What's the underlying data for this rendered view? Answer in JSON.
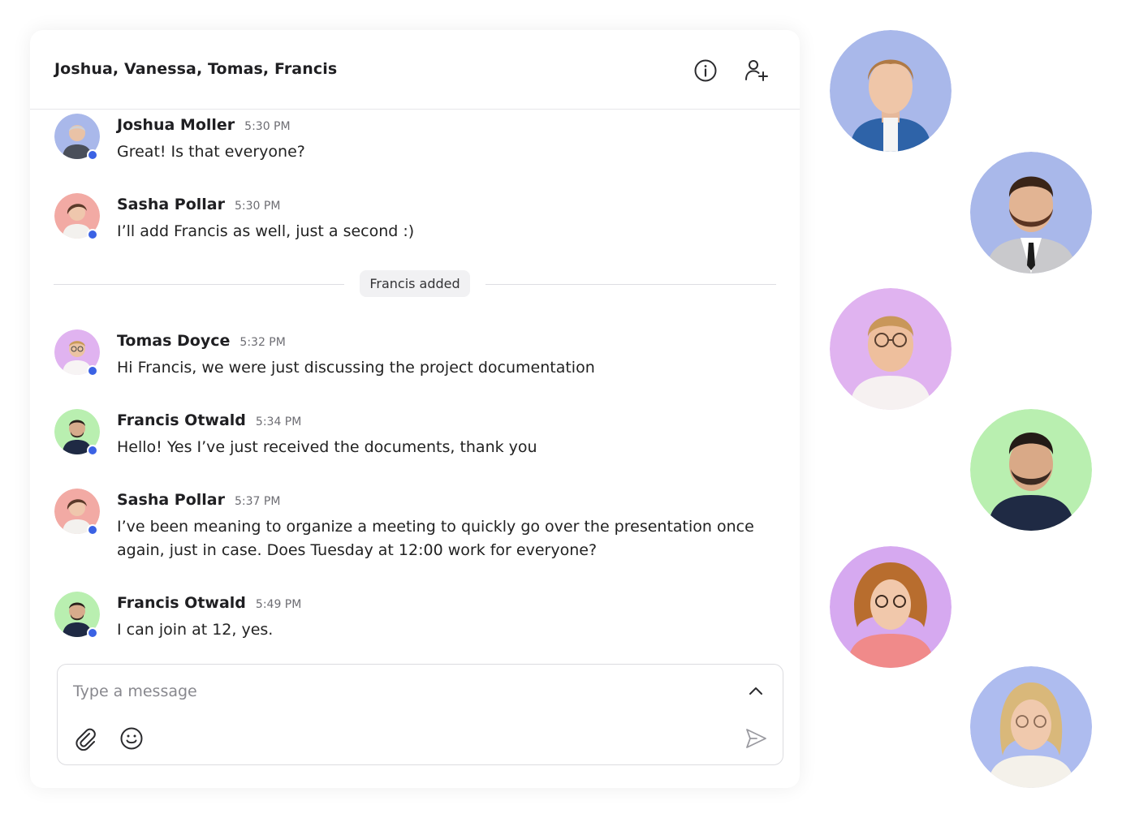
{
  "chat": {
    "title": "Joshua, Vanessa, Tomas, Francis",
    "header_icons": [
      "info-icon",
      "add-user-icon"
    ],
    "messages": [
      {
        "name": "Joshua Moller",
        "time": "5:30 PM",
        "text": "Great! Is that everyone?",
        "avatar_bg": "#a9b8ea"
      },
      {
        "name": "Sasha Pollar",
        "time": "5:30 PM",
        "text": "I’ll add Francis as well, just a second :)",
        "avatar_bg": "#f2aaa4"
      },
      {
        "name": "Tomas Doyce",
        "time": "5:32 PM",
        "text": "Hi Francis, we were just discussing the project documentation",
        "avatar_bg": "#e0b3f0"
      },
      {
        "name": "Francis Otwald",
        "time": "5:34 PM",
        "text": "Hello! Yes I’ve just received the documents, thank you",
        "avatar_bg": "#b9efb0"
      },
      {
        "name": "Sasha Pollar",
        "time": "5:37 PM",
        "text": "I’ve been meaning to organize a meeting to quickly go over the presentation once again, just in case. Does Tuesday at 12:00 work for everyone?",
        "avatar_bg": "#f2aaa4"
      },
      {
        "name": "Francis Otwald",
        "time": "5:49 PM",
        "text": "I can join at 12, yes.",
        "avatar_bg": "#b9efb0"
      }
    ],
    "system_notice": "Francis added",
    "composer": {
      "placeholder": "Type a message",
      "icons": [
        "chevron-up-icon",
        "paperclip-icon",
        "emoji-icon",
        "send-icon"
      ]
    }
  },
  "participants": [
    {
      "bg": "#a9b8ea",
      "shirt": "#2e63a8"
    },
    {
      "bg": "#a9b8ea",
      "shirt": "#c9c9cc"
    },
    {
      "bg": "#e0b3f0",
      "shirt": "#f6f1f1"
    },
    {
      "bg": "#b9efb0",
      "shirt": "#1f2a44"
    },
    {
      "bg": "#d6a9f0",
      "shirt": "#f08a8a"
    },
    {
      "bg": "#aebcef",
      "shirt": "#f4f1ea"
    }
  ],
  "colors": {
    "online": "#3b62e4",
    "border": "#e7e7ea",
    "notice_bg": "#f1f1f3"
  }
}
